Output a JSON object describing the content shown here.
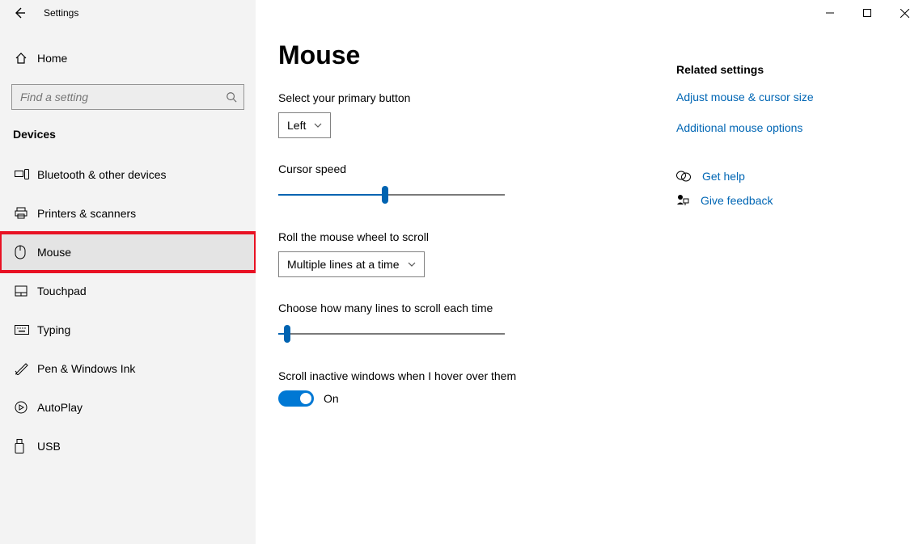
{
  "window": {
    "title": "Settings"
  },
  "sidebar": {
    "home": "Home",
    "search_placeholder": "Find a setting",
    "section": "Devices",
    "items": [
      {
        "label": "Bluetooth & other devices"
      },
      {
        "label": "Printers & scanners"
      },
      {
        "label": "Mouse",
        "highlighted": true
      },
      {
        "label": "Touchpad"
      },
      {
        "label": "Typing"
      },
      {
        "label": "Pen & Windows Ink"
      },
      {
        "label": "AutoPlay"
      },
      {
        "label": "USB"
      }
    ]
  },
  "page": {
    "title": "Mouse",
    "primary_button_label": "Select your primary button",
    "primary_button_value": "Left",
    "cursor_speed_label": "Cursor speed",
    "cursor_speed_percent": 47,
    "wheel_label": "Roll the mouse wheel to scroll",
    "wheel_value": "Multiple lines at a time",
    "lines_label": "Choose how many lines to scroll each time",
    "lines_percent": 4,
    "inactive_label": "Scroll inactive windows when I hover over them",
    "inactive_value": "On"
  },
  "related": {
    "heading": "Related settings",
    "link1": "Adjust mouse & cursor size",
    "link2": "Additional mouse options",
    "help": "Get help",
    "feedback": "Give feedback"
  }
}
